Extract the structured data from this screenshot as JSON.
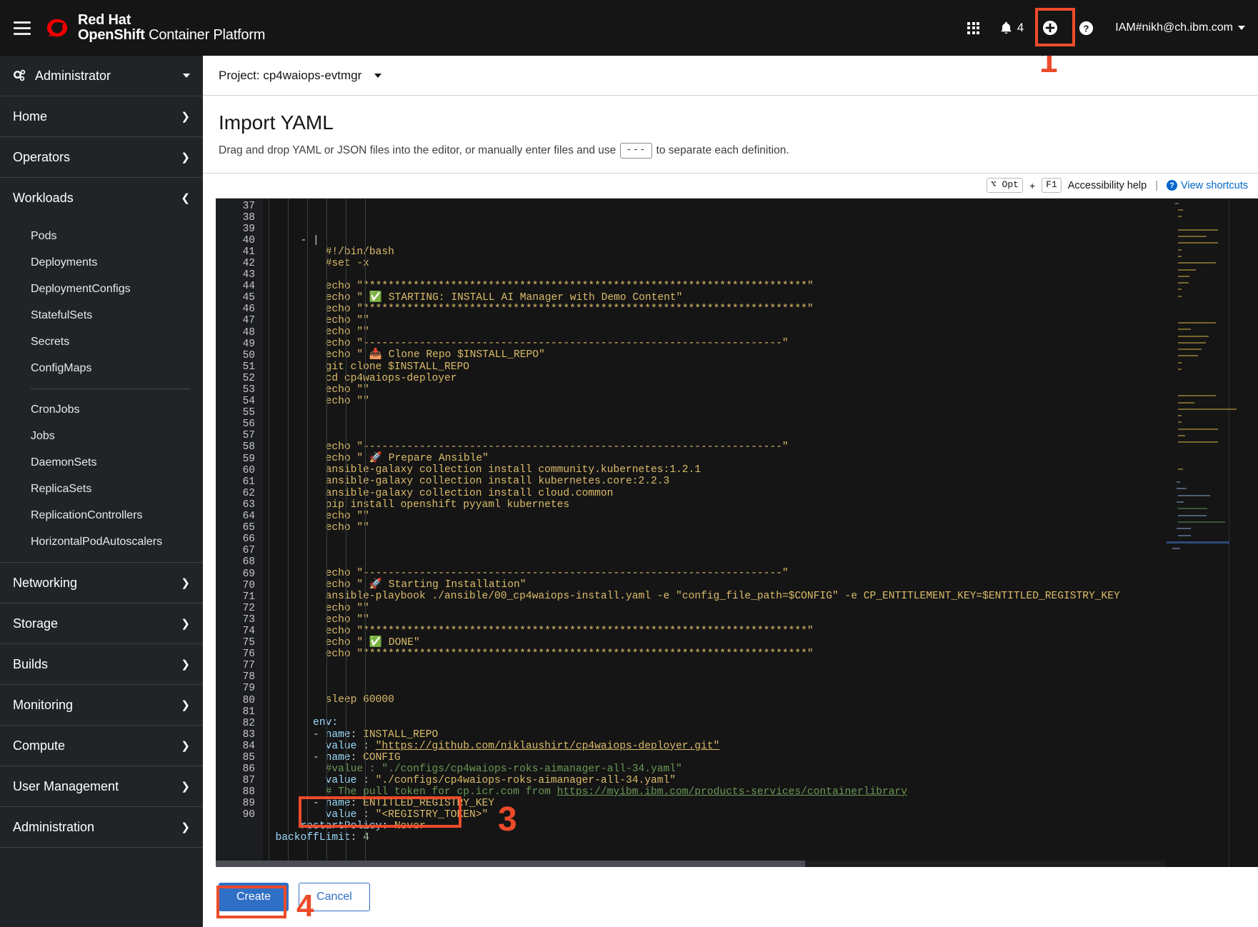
{
  "masthead": {
    "menu_icon": "hamburger-menu-icon",
    "brand_line1": "Red Hat",
    "brand_line2_bold": "OpenShift",
    "brand_line2_rest": " Container Platform",
    "apps_icon": "grid-apps-icon",
    "bell_icon": "bell-icon",
    "notification_count": "4",
    "plus_icon": "plus-circle-icon",
    "help_icon": "question-circle-icon",
    "username": "IAM#nikh@ch.ibm.com"
  },
  "annotations": [
    {
      "number": "1",
      "target": "plus-circle-icon"
    },
    {
      "number": "3",
      "target": "entitled-registry-key-lines"
    },
    {
      "number": "4",
      "target": "create-button"
    }
  ],
  "sidebar": {
    "perspective": "Administrator",
    "groups": [
      {
        "label": "Home",
        "expanded": false
      },
      {
        "label": "Operators",
        "expanded": false
      },
      {
        "label": "Workloads",
        "expanded": true
      }
    ],
    "workloads_items_top": [
      "Pods",
      "Deployments",
      "DeploymentConfigs",
      "StatefulSets",
      "Secrets",
      "ConfigMaps"
    ],
    "workloads_items_bottom": [
      "CronJobs",
      "Jobs",
      "DaemonSets",
      "ReplicaSets",
      "ReplicationControllers",
      "HorizontalPodAutoscalers"
    ],
    "groups_lower": [
      {
        "label": "Networking"
      },
      {
        "label": "Storage"
      },
      {
        "label": "Builds"
      },
      {
        "label": "Monitoring"
      },
      {
        "label": "Compute"
      },
      {
        "label": "User Management"
      },
      {
        "label": "Administration"
      }
    ]
  },
  "project_bar": {
    "label": "Project: cp4waiops-evtmgr"
  },
  "page": {
    "title": "Import YAML",
    "subtitle_before": "Drag and drop YAML or JSON files into the editor, or manually enter files and use",
    "subtitle_chip": "---",
    "subtitle_after": "to separate each definition."
  },
  "editor_toolbar": {
    "key_opt": "⌥ Opt",
    "plus": "+",
    "key_f1": "F1",
    "accessibility_label": "Accessibility help",
    "separator": "|",
    "shortcuts_label": "View shortcuts",
    "help_icon": "question-circle-icon"
  },
  "editor": {
    "first_line_number": 37,
    "lines": [
      {
        "n": 37,
        "tokens": [
          {
            "t": "      - |",
            "c": "s-plain"
          }
        ]
      },
      {
        "n": 38,
        "tokens": [
          {
            "t": "          #!/bin/bash",
            "c": "s-yellow"
          }
        ]
      },
      {
        "n": 39,
        "tokens": [
          {
            "t": "          #set -x",
            "c": "s-yellow"
          }
        ]
      },
      {
        "n": 40,
        "tokens": [
          {
            "t": "",
            "c": "s-plain"
          }
        ]
      },
      {
        "n": 41,
        "tokens": [
          {
            "t": "          echo \"***********************************************************************\"",
            "c": "s-yellow"
          }
        ]
      },
      {
        "n": 42,
        "tokens": [
          {
            "t": "          echo \" ✅ STARTING: INSTALL AI Manager with Demo Content\"",
            "c": "s-yellow"
          }
        ]
      },
      {
        "n": 43,
        "tokens": [
          {
            "t": "          echo \"***********************************************************************\"",
            "c": "s-yellow"
          }
        ]
      },
      {
        "n": 44,
        "tokens": [
          {
            "t": "          echo \"\"",
            "c": "s-yellow"
          }
        ]
      },
      {
        "n": 45,
        "tokens": [
          {
            "t": "          echo \"\"",
            "c": "s-yellow"
          }
        ]
      },
      {
        "n": 46,
        "tokens": [
          {
            "t": "          echo \"-------------------------------------------------------------------\"",
            "c": "s-yellow"
          }
        ]
      },
      {
        "n": 47,
        "tokens": [
          {
            "t": "          echo \" 📥 Clone Repo $INSTALL_REPO\"",
            "c": "s-yellow"
          }
        ]
      },
      {
        "n": 48,
        "tokens": [
          {
            "t": "          git clone $INSTALL_REPO",
            "c": "s-yellow"
          }
        ]
      },
      {
        "n": 49,
        "tokens": [
          {
            "t": "          cd cp4waiops-deployer",
            "c": "s-yellow"
          }
        ]
      },
      {
        "n": 50,
        "tokens": [
          {
            "t": "          echo \"\"",
            "c": "s-yellow"
          }
        ]
      },
      {
        "n": 51,
        "tokens": [
          {
            "t": "          echo \"\"",
            "c": "s-yellow"
          }
        ]
      },
      {
        "n": 52,
        "tokens": [
          {
            "t": "",
            "c": "s-plain"
          }
        ]
      },
      {
        "n": 53,
        "tokens": [
          {
            "t": "",
            "c": "s-plain"
          }
        ]
      },
      {
        "n": 54,
        "tokens": [
          {
            "t": "",
            "c": "s-plain"
          }
        ]
      },
      {
        "n": 55,
        "tokens": [
          {
            "t": "          echo \"-------------------------------------------------------------------\"",
            "c": "s-yellow"
          }
        ]
      },
      {
        "n": 56,
        "tokens": [
          {
            "t": "          echo \" 🚀 Prepare Ansible\"",
            "c": "s-yellow"
          }
        ]
      },
      {
        "n": 57,
        "tokens": [
          {
            "t": "          ansible-galaxy collection install community.kubernetes:1.2.1",
            "c": "s-yellow"
          }
        ]
      },
      {
        "n": 58,
        "tokens": [
          {
            "t": "          ansible-galaxy collection install kubernetes.core:2.2.3",
            "c": "s-yellow"
          }
        ]
      },
      {
        "n": 59,
        "tokens": [
          {
            "t": "          ansible-galaxy collection install cloud.common",
            "c": "s-yellow"
          }
        ]
      },
      {
        "n": 60,
        "tokens": [
          {
            "t": "          pip install openshift pyyaml kubernetes",
            "c": "s-yellow"
          }
        ]
      },
      {
        "n": 61,
        "tokens": [
          {
            "t": "          echo \"\"",
            "c": "s-yellow"
          }
        ]
      },
      {
        "n": 62,
        "tokens": [
          {
            "t": "          echo \"\"",
            "c": "s-yellow"
          }
        ]
      },
      {
        "n": 63,
        "tokens": [
          {
            "t": "",
            "c": "s-plain"
          }
        ]
      },
      {
        "n": 64,
        "tokens": [
          {
            "t": "",
            "c": "s-plain"
          }
        ]
      },
      {
        "n": 65,
        "tokens": [
          {
            "t": "",
            "c": "s-plain"
          }
        ]
      },
      {
        "n": 66,
        "tokens": [
          {
            "t": "          echo \"-------------------------------------------------------------------\"",
            "c": "s-yellow"
          }
        ]
      },
      {
        "n": 67,
        "tokens": [
          {
            "t": "          echo \" 🚀 Starting Installation\"",
            "c": "s-yellow"
          }
        ]
      },
      {
        "n": 68,
        "tokens": [
          {
            "t": "          ansible-playbook ./ansible/00_cp4waiops-install.yaml -e \"config_file_path=$CONFIG\" -e CP_ENTITLEMENT_KEY=$ENTITLED_REGISTRY_KEY",
            "c": "s-yellow"
          }
        ]
      },
      {
        "n": 69,
        "tokens": [
          {
            "t": "          echo \"\"",
            "c": "s-yellow"
          }
        ]
      },
      {
        "n": 70,
        "tokens": [
          {
            "t": "          echo \"\"",
            "c": "s-yellow"
          }
        ]
      },
      {
        "n": 71,
        "tokens": [
          {
            "t": "          echo \"***********************************************************************\"",
            "c": "s-yellow"
          }
        ]
      },
      {
        "n": 72,
        "tokens": [
          {
            "t": "          echo \" ✅ DONE\"",
            "c": "s-yellow"
          }
        ]
      },
      {
        "n": 73,
        "tokens": [
          {
            "t": "          echo \"***********************************************************************\"",
            "c": "s-yellow"
          }
        ]
      },
      {
        "n": 74,
        "tokens": [
          {
            "t": "",
            "c": "s-plain"
          }
        ]
      },
      {
        "n": 75,
        "tokens": [
          {
            "t": "",
            "c": "s-plain"
          }
        ]
      },
      {
        "n": 76,
        "tokens": [
          {
            "t": "",
            "c": "s-plain"
          }
        ]
      },
      {
        "n": 77,
        "tokens": [
          {
            "t": "          sleep 60000",
            "c": "s-yellow"
          }
        ]
      },
      {
        "n": 78,
        "tokens": [
          {
            "t": "",
            "c": "s-plain"
          }
        ]
      },
      {
        "n": 79,
        "tokens": [
          {
            "t": "        env:",
            "c": "s-key"
          }
        ]
      },
      {
        "n": 80,
        "tokens": [
          {
            "t": "        - ",
            "c": "s-plain"
          },
          {
            "t": "name",
            "c": "s-key"
          },
          {
            "t": ": ",
            "c": "s-plain"
          },
          {
            "t": "INSTALL_REPO",
            "c": "s-yellow"
          }
        ]
      },
      {
        "n": 81,
        "tokens": [
          {
            "t": "          ",
            "c": "s-plain"
          },
          {
            "t": "value ",
            "c": "s-key"
          },
          {
            "t": ": ",
            "c": "s-plain"
          },
          {
            "t": "\"https://github.com/niklaushirt/cp4waiops-deployer.git\"",
            "c": "s-link"
          }
        ]
      },
      {
        "n": 82,
        "tokens": [
          {
            "t": "        - ",
            "c": "s-plain"
          },
          {
            "t": "name",
            "c": "s-key"
          },
          {
            "t": ": ",
            "c": "s-plain"
          },
          {
            "t": "CONFIG",
            "c": "s-yellow"
          }
        ]
      },
      {
        "n": 83,
        "tokens": [
          {
            "t": "          #value : \"./configs/cp4waiops-roks-aimanager-all-34.yaml\"",
            "c": "s-comment"
          }
        ]
      },
      {
        "n": 84,
        "tokens": [
          {
            "t": "          ",
            "c": "s-plain"
          },
          {
            "t": "value ",
            "c": "s-key"
          },
          {
            "t": ": ",
            "c": "s-plain"
          },
          {
            "t": "\"./configs/cp4waiops-roks-aimanager-all-34.yaml\"",
            "c": "s-yellow"
          }
        ]
      },
      {
        "n": 85,
        "tokens": [
          {
            "t": "          # The pull token for cp.icr.com from ",
            "c": "s-comment"
          },
          {
            "t": "https://myibm.ibm.com/products-services/containerlibrary",
            "c": "s-link-g"
          }
        ]
      },
      {
        "n": 86,
        "tokens": [
          {
            "t": "        - ",
            "c": "s-plain"
          },
          {
            "t": "name",
            "c": "s-key"
          },
          {
            "t": ": ",
            "c": "s-plain"
          },
          {
            "t": "ENTITLED_REGISTRY_KEY",
            "c": "s-yellow"
          }
        ]
      },
      {
        "n": 87,
        "tokens": [
          {
            "t": "          ",
            "c": "s-plain"
          },
          {
            "t": "value ",
            "c": "s-key"
          },
          {
            "t": ": ",
            "c": "s-plain"
          },
          {
            "t": "\"<REGISTRY_TOKEN>\"",
            "c": "s-yellow"
          }
        ]
      },
      {
        "n": 88,
        "tokens": [
          {
            "t": "      ",
            "c": "s-plain"
          },
          {
            "t": "restartPolicy",
            "c": "s-key"
          },
          {
            "t": ": ",
            "c": "s-plain"
          },
          {
            "t": "Never",
            "c": "s-yellow"
          }
        ]
      },
      {
        "n": 89,
        "tokens": [
          {
            "t": "  ",
            "c": "s-plain"
          },
          {
            "t": "backoffLimit",
            "c": "s-key"
          },
          {
            "t": ": ",
            "c": "s-plain"
          },
          {
            "t": "4",
            "c": "s-num"
          }
        ]
      },
      {
        "n": 90,
        "tokens": [
          {
            "t": "",
            "c": "s-plain"
          }
        ]
      }
    ]
  },
  "footer": {
    "create_label": "Create",
    "cancel_label": "Cancel"
  }
}
